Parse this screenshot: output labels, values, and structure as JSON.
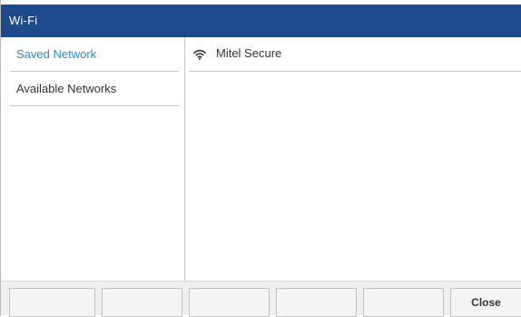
{
  "title_bar": {
    "title": "Wi-Fi"
  },
  "sidebar": {
    "items": [
      {
        "label": "Saved Network",
        "active": true
      },
      {
        "label": "Available Networks",
        "active": false
      }
    ]
  },
  "networks": [
    {
      "name": "Mitel Secure",
      "icon": "wifi-signal-icon"
    }
  ],
  "softkeys": [
    {
      "label": ""
    },
    {
      "label": ""
    },
    {
      "label": ""
    },
    {
      "label": ""
    },
    {
      "label": ""
    },
    {
      "label": "Close"
    }
  ],
  "colors": {
    "title_bar_bg": "#1d4a8a",
    "active_item": "#2b8fd0",
    "text": "#333333"
  }
}
